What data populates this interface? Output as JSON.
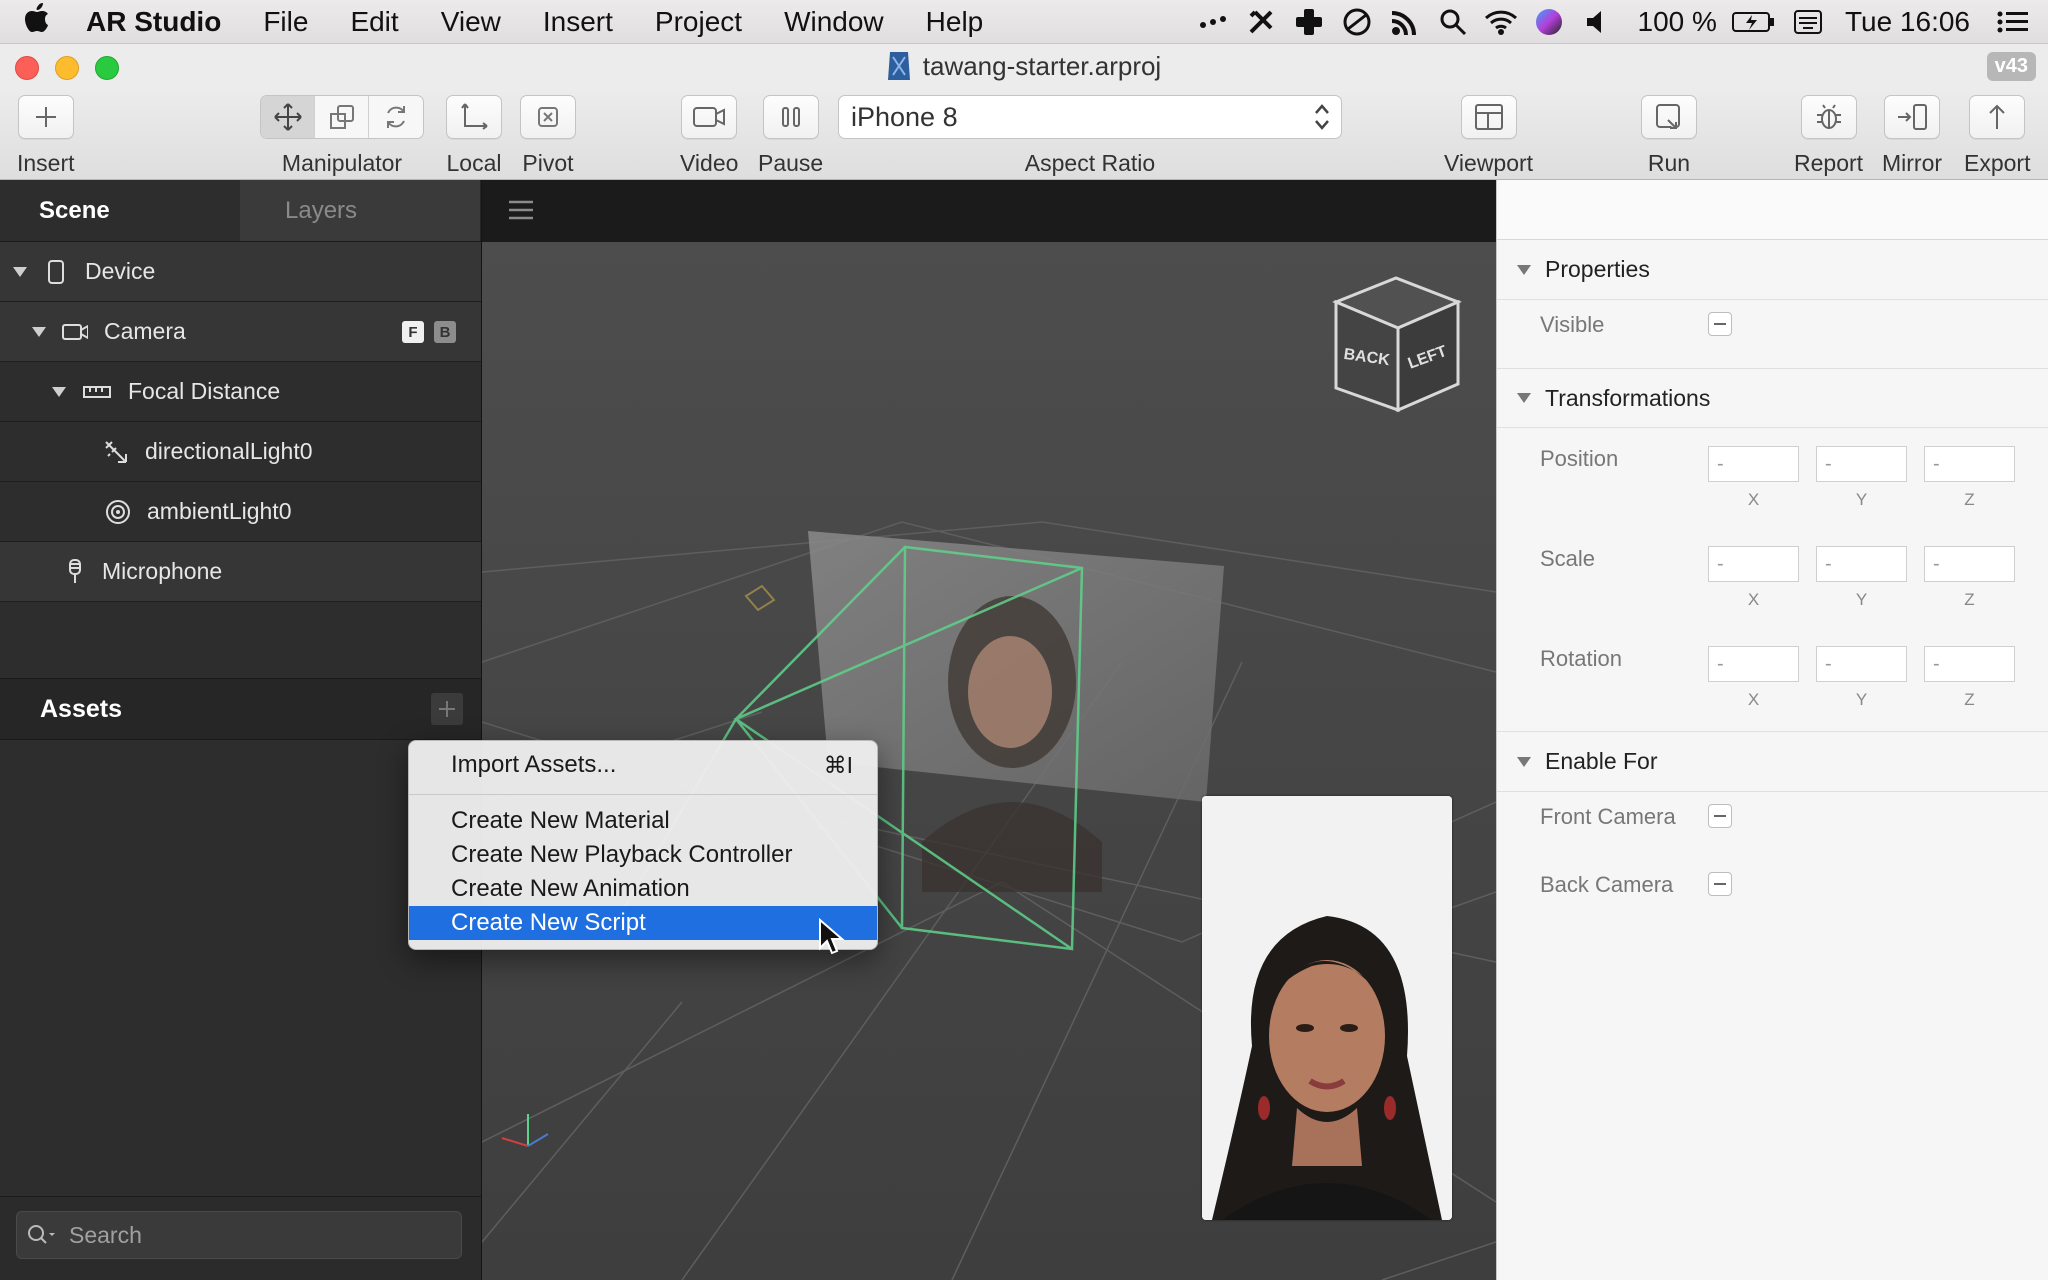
{
  "menubar": {
    "app_name": "AR Studio",
    "items": [
      "File",
      "Edit",
      "View",
      "Insert",
      "Project",
      "Window",
      "Help"
    ],
    "battery": "100 %",
    "clock": "Tue 16:06"
  },
  "window": {
    "title": "tawang-starter.arproj",
    "version": "v43"
  },
  "toolbar": {
    "insert": "Insert",
    "manipulator": "Manipulator",
    "local": "Local",
    "pivot": "Pivot",
    "video": "Video",
    "pause": "Pause",
    "device_value": "iPhone 8",
    "aspect_ratio": "Aspect Ratio",
    "viewport": "Viewport",
    "run": "Run",
    "report": "Report",
    "mirror": "Mirror",
    "export": "Export"
  },
  "scene_panel": {
    "tabs": [
      "Scene",
      "Layers"
    ],
    "tree": [
      {
        "label": "Device"
      },
      {
        "label": "Camera",
        "badges": [
          "F",
          "B"
        ]
      },
      {
        "label": "Focal Distance"
      },
      {
        "label": "directionalLight0"
      },
      {
        "label": "ambientLight0"
      },
      {
        "label": "Microphone"
      }
    ]
  },
  "assets": {
    "title": "Assets",
    "search_placeholder": "Search"
  },
  "viewport": {
    "cube_faces": [
      "BACK",
      "LEFT"
    ]
  },
  "context_menu": {
    "import": "Import Assets...",
    "import_shortcut": "⌘I",
    "items": [
      "Create New Material",
      "Create New Playback Controller",
      "Create New Animation",
      "Create New Script"
    ],
    "highlighted": "Create New Script"
  },
  "properties": {
    "section_properties": "Properties",
    "visible": "Visible",
    "section_transformations": "Transformations",
    "position": "Position",
    "scale": "Scale",
    "rotation": "Rotation",
    "axes": [
      "X",
      "Y",
      "Z"
    ],
    "empty_value": "-",
    "section_enable_for": "Enable For",
    "front_camera": "Front Camera",
    "back_camera": "Back Camera"
  },
  "colors": {
    "selection_blue": "#1f6fe0",
    "gizmo_green": "#5fd38a"
  }
}
